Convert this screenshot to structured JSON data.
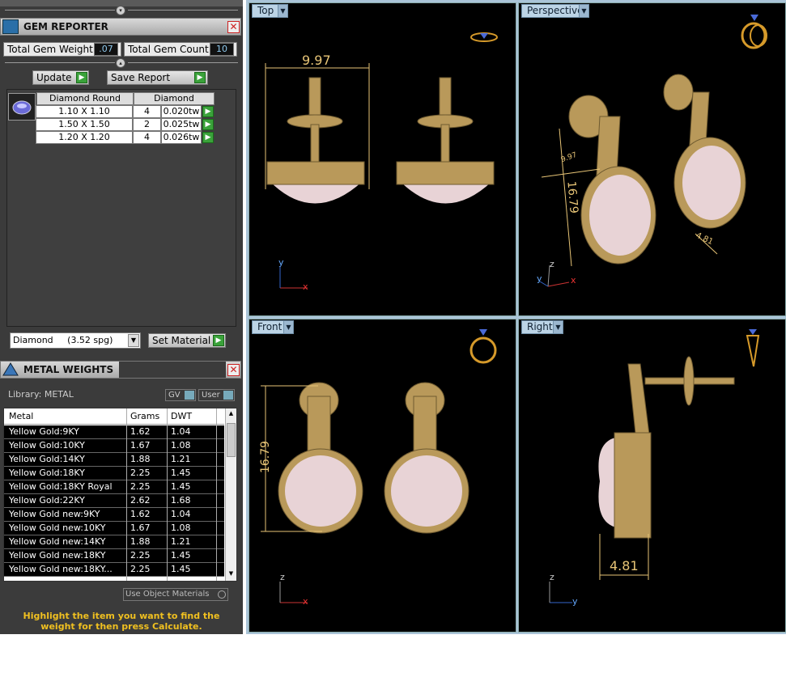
{
  "gem_reporter": {
    "title": "GEM REPORTER",
    "total_weight_label": "Total Gem Weight",
    "total_weight_value": ".07",
    "total_count_label": "Total Gem Count",
    "total_count_value": "10",
    "update_label": "Update",
    "save_report_label": "Save Report",
    "col_shape": "Diamond Round",
    "col_material": "Diamond",
    "rows": [
      {
        "size": "1.10 X 1.10",
        "count": "4",
        "weight": "0.020tw"
      },
      {
        "size": "1.50 X 1.50",
        "count": "2",
        "weight": "0.025tw"
      },
      {
        "size": "1.20 X 1.20",
        "count": "4",
        "weight": "0.026tw"
      }
    ],
    "material_select": "Diamond     (3.52 spg)",
    "set_material_label": "Set Material"
  },
  "metal_weights": {
    "title": "METAL WEIGHTS",
    "library_label": "Library: METAL",
    "gv_label": "GV",
    "user_label": "User",
    "col_metal": "Metal",
    "col_grams": "Grams",
    "col_dwt": "DWT",
    "rows": [
      {
        "metal": "Yellow Gold:9KY",
        "grams": "1.62",
        "dwt": "1.04"
      },
      {
        "metal": "Yellow Gold:10KY",
        "grams": "1.67",
        "dwt": "1.08"
      },
      {
        "metal": "Yellow Gold:14KY",
        "grams": "1.88",
        "dwt": "1.21"
      },
      {
        "metal": "Yellow Gold:18KY",
        "grams": "2.25",
        "dwt": "1.45"
      },
      {
        "metal": "Yellow Gold:18KY Royal",
        "grams": "2.25",
        "dwt": "1.45"
      },
      {
        "metal": "Yellow Gold:22KY",
        "grams": "2.62",
        "dwt": "1.68"
      },
      {
        "metal": "Yellow Gold new:9KY",
        "grams": "1.62",
        "dwt": "1.04"
      },
      {
        "metal": "Yellow Gold new:10KY",
        "grams": "1.67",
        "dwt": "1.08"
      },
      {
        "metal": "Yellow Gold new:14KY",
        "grams": "1.88",
        "dwt": "1.21"
      },
      {
        "metal": "Yellow Gold new:18KY",
        "grams": "2.25",
        "dwt": "1.45"
      },
      {
        "metal": "Yellow Gold new:18KY...",
        "grams": "2.25",
        "dwt": "1.45"
      }
    ],
    "use_object_materials_label": "Use Object Materials",
    "hint": "Highlight the item you want to find the weight for then press Calculate."
  },
  "viewports": {
    "top": {
      "label": "Top",
      "dimension": "9.97",
      "axis1": "y",
      "axis2": "x"
    },
    "perspective": {
      "label": "Perspective",
      "dim_a": "9.97",
      "dim_b": "16.79",
      "dim_c": "4.81",
      "axis1": "z",
      "axis2": "y",
      "axis3": "x"
    },
    "front": {
      "label": "Front",
      "dimension": "16.79",
      "axis1": "z",
      "axis2": "x"
    },
    "right": {
      "label": "Right",
      "dimension": "4.81",
      "axis1": "z",
      "axis2": "y"
    }
  },
  "colors": {
    "accent_label": "#bcd4e6",
    "dimension": "#e7c476",
    "hint_text": "#f0c020",
    "green_button": "#3aa23a"
  }
}
